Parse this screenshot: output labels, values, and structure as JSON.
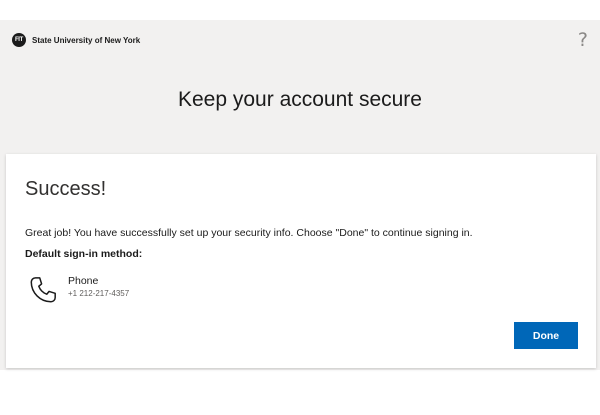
{
  "header": {
    "logo_text": "FIT",
    "org_name": "State University of New York",
    "help_symbol": "?"
  },
  "page": {
    "title": "Keep your account secure"
  },
  "card": {
    "title": "Success!",
    "message": "Great job! You have successfully set up your security info. Choose \"Done\" to continue signing in.",
    "default_method_label": "Default sign-in method:",
    "method": {
      "icon": "phone-icon",
      "name": "Phone",
      "value": "+1 212-217-4357"
    },
    "done_label": "Done"
  },
  "colors": {
    "accent": "#0067b8",
    "background": "#f2f1f0",
    "card": "#ffffff"
  }
}
